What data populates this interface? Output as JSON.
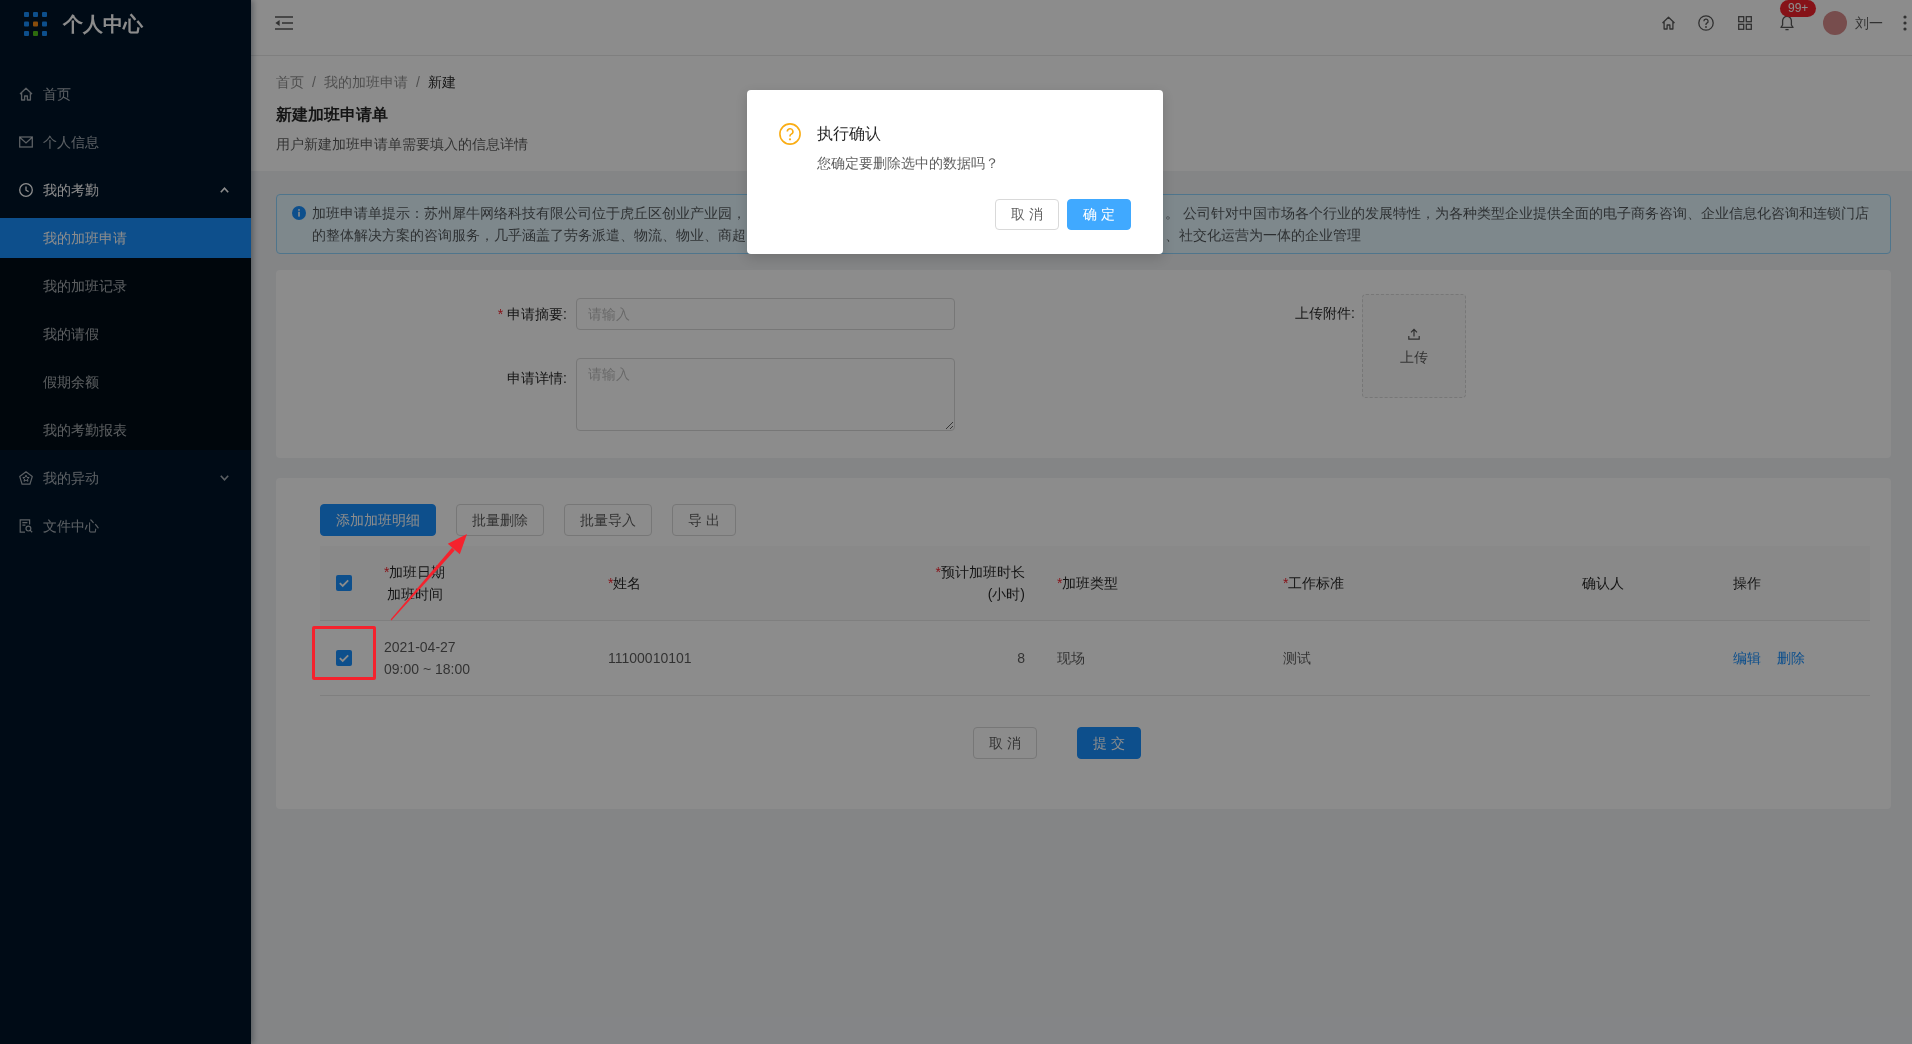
{
  "sidebar": {
    "logo": "个人中心",
    "items": [
      {
        "label": "首页",
        "selected": false
      },
      {
        "label": "个人信息",
        "selected": false
      },
      {
        "label": "我的考勤",
        "selected": false,
        "expanded": true,
        "children": [
          {
            "label": "我的加班申请",
            "selected": true
          },
          {
            "label": "我的加班记录",
            "selected": false
          },
          {
            "label": "我的请假",
            "selected": false
          },
          {
            "label": "假期余额",
            "selected": false
          },
          {
            "label": "我的考勤报表",
            "selected": false
          }
        ]
      },
      {
        "label": "我的异动",
        "selected": false,
        "expanded": false
      },
      {
        "label": "文件中心",
        "selected": false
      }
    ]
  },
  "top_bar": {
    "notification_badge": "99+",
    "user_name": "刘一"
  },
  "page_header": {
    "breadcrumb": [
      {
        "label": "首页",
        "separator": "/",
        "current": false
      },
      {
        "label": "我的加班申请",
        "separator": "/",
        "current": false
      },
      {
        "label": "新建",
        "current": true
      }
    ],
    "title": "新建加班申请单",
    "description": "用户新建加班申请单需要填入的信息详情"
  },
  "alert": {
    "lines_left": [
      "加班申请单提示：苏州犀牛网络科技有限公司位于虎丘区创业产业园，",
      "的整体解决方案的咨询服务，几乎涵盖了劳务派遣、物流、物业、商超"
    ],
    "lines_right": [
      "。 公司针对中国市场各个行业的发展特性，为各种类型企业提供全面的电子商务咨询、企业信息化咨询和连锁门店",
      "、社交化运营为一体的企业管理"
    ]
  },
  "form": {
    "fields": [
      {
        "kind": "input",
        "required_mark": "*",
        "label": "申请摘要:",
        "placeholder": "请输入"
      },
      {
        "kind": "textarea",
        "label": "申请详情:",
        "placeholder": "请输入"
      }
    ],
    "upload": {
      "label": "上传附件:",
      "button": "上传"
    }
  },
  "table": {
    "toolbar": [
      {
        "label": "添加加班明细",
        "kind": "primary"
      },
      {
        "label": "批量删除",
        "kind": "default"
      },
      {
        "label": "批量导入",
        "kind": "default"
      },
      {
        "label": "导 出",
        "kind": "default"
      }
    ],
    "select_all_checked": true,
    "columns": [
      {
        "required_mark": "*",
        "label": "加班日期",
        "line_2": "加班时间"
      },
      {
        "required_mark": "*",
        "label": "姓名"
      },
      {
        "required_mark": "*",
        "label": "预计加班时长",
        "line_2": "(小时)"
      },
      {
        "required_mark": "*",
        "label": "加班类型"
      },
      {
        "required_mark": "*",
        "label": "工作标准"
      },
      {
        "label": "确认人"
      },
      {
        "label": "操作"
      }
    ],
    "rows": [
      {
        "selected": true,
        "date": "2021-04-27",
        "time": "09:00 ~ 18:00",
        "name": "11100010101",
        "hours": "8",
        "type": "现场",
        "standard": "测试",
        "actions": [
          {
            "label": "编辑"
          },
          {
            "label": "删除"
          }
        ]
      }
    ],
    "footer_buttons": [
      {
        "label": "取 消",
        "kind": "default"
      },
      {
        "label": "提 交",
        "kind": "primary"
      }
    ]
  },
  "dialog": {
    "title": "执行确认",
    "message": "您确定要删除选中的数据吗？",
    "buttons": [
      {
        "label": "取 消",
        "kind": "default"
      },
      {
        "label": "确 定",
        "kind": "primary"
      }
    ]
  },
  "annotations": [
    {
      "kind": "frame"
    },
    {
      "kind": "arrow"
    }
  ]
}
